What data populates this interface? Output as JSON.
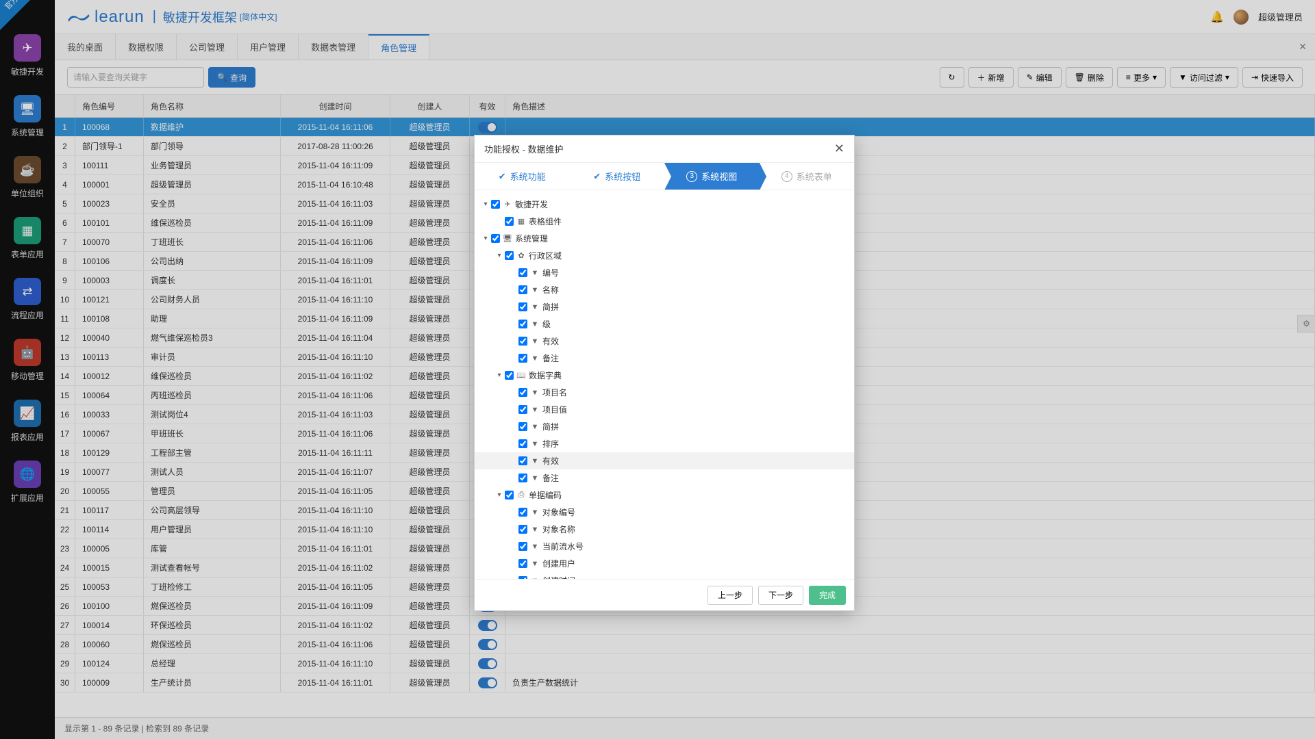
{
  "corner_badge": "官方",
  "brand": "learun",
  "subtitle": "敏捷开发框架",
  "lang": "[简体中文]",
  "user": "超级管理员",
  "sidebar": [
    {
      "label": "敏捷开发",
      "cls": "ic-purple",
      "glyph": "✈"
    },
    {
      "label": "系统管理",
      "cls": "ic-blue",
      "glyph": "🖥"
    },
    {
      "label": "单位组织",
      "cls": "ic-brown",
      "glyph": "☕"
    },
    {
      "label": "表单应用",
      "cls": "ic-teal",
      "glyph": "▦"
    },
    {
      "label": "流程应用",
      "cls": "ic-blue2",
      "glyph": "⇄"
    },
    {
      "label": "移动管理",
      "cls": "ic-red",
      "glyph": "🤖"
    },
    {
      "label": "报表应用",
      "cls": "ic-blue3",
      "glyph": "📈"
    },
    {
      "label": "扩展应用",
      "cls": "ic-purple2",
      "glyph": "🌐"
    }
  ],
  "tabs": [
    "我的桌面",
    "数据权限",
    "公司管理",
    "用户管理",
    "数据表管理",
    "角色管理"
  ],
  "active_tab": 5,
  "search_placeholder": "请输入要查询关键字",
  "search_btn": "查询",
  "toolbar_right": {
    "refresh": "↻",
    "add": "新增",
    "edit": "编辑",
    "delete": "删除",
    "more": "更多",
    "filter": "访问过滤",
    "export": "快速导入"
  },
  "columns": {
    "idx": "",
    "code": "角色编号",
    "name": "角色名称",
    "time": "创建时间",
    "creator": "创建人",
    "valid": "有效",
    "desc": "角色描述"
  },
  "rows": [
    {
      "n": 1,
      "code": "100068",
      "name": "数据维护",
      "time": "2015-11-04 16:11:06",
      "by": "超级管理员",
      "desc": ""
    },
    {
      "n": 2,
      "code": "部门领导-1",
      "name": "部门领导",
      "time": "2017-08-28 11:00:26",
      "by": "超级管理员",
      "desc": ""
    },
    {
      "n": 3,
      "code": "100111",
      "name": "业务管理员",
      "time": "2015-11-04 16:11:09",
      "by": "超级管理员",
      "desc": ""
    },
    {
      "n": 4,
      "code": "100001",
      "name": "超级管理员",
      "time": "2015-11-04 16:10:48",
      "by": "超级管理员",
      "desc": ""
    },
    {
      "n": 5,
      "code": "100023",
      "name": "安全员",
      "time": "2015-11-04 16:11:03",
      "by": "超级管理员",
      "desc": ""
    },
    {
      "n": 6,
      "code": "100101",
      "name": "维保巡检员",
      "time": "2015-11-04 16:11:09",
      "by": "超级管理员",
      "desc": ""
    },
    {
      "n": 7,
      "code": "100070",
      "name": "丁班班长",
      "time": "2015-11-04 16:11:06",
      "by": "超级管理员",
      "desc": ""
    },
    {
      "n": 8,
      "code": "100106",
      "name": "公司出纳",
      "time": "2015-11-04 16:11:09",
      "by": "超级管理员",
      "desc": ""
    },
    {
      "n": 9,
      "code": "100003",
      "name": "调度长",
      "time": "2015-11-04 16:11:01",
      "by": "超级管理员",
      "desc": ""
    },
    {
      "n": 10,
      "code": "100121",
      "name": "公司财务人员",
      "time": "2015-11-04 16:11:10",
      "by": "超级管理员",
      "desc": ""
    },
    {
      "n": 11,
      "code": "100108",
      "name": "助理",
      "time": "2015-11-04 16:11:09",
      "by": "超级管理员",
      "desc": ""
    },
    {
      "n": 12,
      "code": "100040",
      "name": "燃气维保巡检员3",
      "time": "2015-11-04 16:11:04",
      "by": "超级管理员",
      "desc": ""
    },
    {
      "n": 13,
      "code": "100113",
      "name": "审计员",
      "time": "2015-11-04 16:11:10",
      "by": "超级管理员",
      "desc": ""
    },
    {
      "n": 14,
      "code": "100012",
      "name": "维保巡检员",
      "time": "2015-11-04 16:11:02",
      "by": "超级管理员",
      "desc": ""
    },
    {
      "n": 15,
      "code": "100064",
      "name": "丙班巡检员",
      "time": "2015-11-04 16:11:06",
      "by": "超级管理员",
      "desc": ""
    },
    {
      "n": 16,
      "code": "100033",
      "name": "测试岗位4",
      "time": "2015-11-04 16:11:03",
      "by": "超级管理员",
      "desc": ""
    },
    {
      "n": 17,
      "code": "100067",
      "name": "甲班班长",
      "time": "2015-11-04 16:11:06",
      "by": "超级管理员",
      "desc": ""
    },
    {
      "n": 18,
      "code": "100129",
      "name": "工程部主管",
      "time": "2015-11-04 16:11:11",
      "by": "超级管理员",
      "desc": ""
    },
    {
      "n": 19,
      "code": "100077",
      "name": "测试人员",
      "time": "2015-11-04 16:11:07",
      "by": "超级管理员",
      "desc": ""
    },
    {
      "n": 20,
      "code": "100055",
      "name": "管理员",
      "time": "2015-11-04 16:11:05",
      "by": "超级管理员",
      "desc": ""
    },
    {
      "n": 21,
      "code": "100117",
      "name": "公司高层领导",
      "time": "2015-11-04 16:11:10",
      "by": "超级管理员",
      "desc": ""
    },
    {
      "n": 22,
      "code": "100114",
      "name": "用户管理员",
      "time": "2015-11-04 16:11:10",
      "by": "超级管理员",
      "desc": ""
    },
    {
      "n": 23,
      "code": "100005",
      "name": "库管",
      "time": "2015-11-04 16:11:01",
      "by": "超级管理员",
      "desc": ""
    },
    {
      "n": 24,
      "code": "100015",
      "name": "测试查看帐号",
      "time": "2015-11-04 16:11:02",
      "by": "超级管理员",
      "desc": ""
    },
    {
      "n": 25,
      "code": "100053",
      "name": "丁班检修工",
      "time": "2015-11-04 16:11:05",
      "by": "超级管理员",
      "desc": ""
    },
    {
      "n": 26,
      "code": "100100",
      "name": "燃保巡检员",
      "time": "2015-11-04 16:11:09",
      "by": "超级管理员",
      "desc": ""
    },
    {
      "n": 27,
      "code": "100014",
      "name": "环保巡检员",
      "time": "2015-11-04 16:11:02",
      "by": "超级管理员",
      "desc": ""
    },
    {
      "n": 28,
      "code": "100060",
      "name": "燃保巡检员",
      "time": "2015-11-04 16:11:06",
      "by": "超级管理员",
      "desc": ""
    },
    {
      "n": 29,
      "code": "100124",
      "name": "总经理",
      "time": "2015-11-04 16:11:10",
      "by": "超级管理员",
      "desc": ""
    },
    {
      "n": 30,
      "code": "100009",
      "name": "生产统计员",
      "time": "2015-11-04 16:11:01",
      "by": "超级管理员",
      "desc": "负责生产数据统计"
    }
  ],
  "selected_row": 0,
  "footer": "显示第 1 - 89 条记录  |  检索到 89 条记录",
  "dialog": {
    "title": "功能授权 - 数据维护",
    "steps": [
      "系统功能",
      "系统按钮",
      "系统视图",
      "系统表单"
    ],
    "active_step": 2,
    "prev": "上一步",
    "next": "下一步",
    "finish": "完成",
    "tree": [
      {
        "d": 0,
        "exp": "▾",
        "ico": "✈",
        "t": "敏捷开发"
      },
      {
        "d": 1,
        "exp": "",
        "ico": "▦",
        "t": "表格组件"
      },
      {
        "d": 0,
        "exp": "▾",
        "ico": "🖥",
        "t": "系统管理"
      },
      {
        "d": 1,
        "exp": "▾",
        "ico": "✿",
        "t": "行政区域"
      },
      {
        "d": 2,
        "exp": "",
        "ico": "▼",
        "t": "编号"
      },
      {
        "d": 2,
        "exp": "",
        "ico": "▼",
        "t": "名称"
      },
      {
        "d": 2,
        "exp": "",
        "ico": "▼",
        "t": "简拼"
      },
      {
        "d": 2,
        "exp": "",
        "ico": "▼",
        "t": "级"
      },
      {
        "d": 2,
        "exp": "",
        "ico": "▼",
        "t": "有效"
      },
      {
        "d": 2,
        "exp": "",
        "ico": "▼",
        "t": "备注"
      },
      {
        "d": 1,
        "exp": "▾",
        "ico": "📖",
        "t": "数据字典"
      },
      {
        "d": 2,
        "exp": "",
        "ico": "▼",
        "t": "项目名"
      },
      {
        "d": 2,
        "exp": "",
        "ico": "▼",
        "t": "项目值"
      },
      {
        "d": 2,
        "exp": "",
        "ico": "▼",
        "t": "简拼"
      },
      {
        "d": 2,
        "exp": "",
        "ico": "▼",
        "t": "排序"
      },
      {
        "d": 2,
        "exp": "",
        "ico": "▼",
        "t": "有效",
        "hov": true
      },
      {
        "d": 2,
        "exp": "",
        "ico": "▼",
        "t": "备注"
      },
      {
        "d": 1,
        "exp": "▾",
        "ico": "⎙",
        "t": "单据编码"
      },
      {
        "d": 2,
        "exp": "",
        "ico": "▼",
        "t": "对象编号"
      },
      {
        "d": 2,
        "exp": "",
        "ico": "▼",
        "t": "对象名称"
      },
      {
        "d": 2,
        "exp": "",
        "ico": "▼",
        "t": "当前流水号"
      },
      {
        "d": 2,
        "exp": "",
        "ico": "▼",
        "t": "创建用户"
      },
      {
        "d": 2,
        "exp": "",
        "ico": "▼",
        "t": "创建时间"
      }
    ]
  }
}
